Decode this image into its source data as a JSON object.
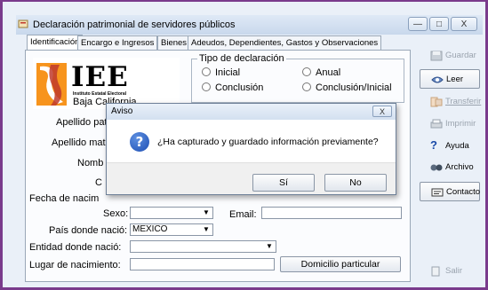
{
  "window": {
    "title": "Declaración patrimonial de servidores públicos",
    "minimize": "—",
    "maximize": "□",
    "close": "X"
  },
  "tabs": [
    {
      "label": "Identificación"
    },
    {
      "label": "Encargo e Ingresos"
    },
    {
      "label": "Bienes"
    },
    {
      "label": "Adeudos, Dependientes, Gastos y Observaciones"
    }
  ],
  "logo": {
    "text": "IEE",
    "subtext": "Instituto Estatal Electoral",
    "region": "Baja California"
  },
  "tipo_declaracion": {
    "legend": "Tipo de declaración",
    "options": [
      {
        "label": "Inicial"
      },
      {
        "label": "Anual"
      },
      {
        "label": "Conclusión"
      },
      {
        "label": "Conclusión/Inicial"
      }
    ]
  },
  "form": {
    "apellido_paterno_label": "Apellido pat",
    "apellido_materno_label": "Apellido mate",
    "nombre_label": "Nomb",
    "curp_label": "C",
    "fecha_label": "Fecha de nacim",
    "sexo_label": "Sexo:",
    "sexo_value": "",
    "email_label": "Email:",
    "pais_label": "País donde nació:",
    "pais_value": "MEXICO",
    "entidad_label": "Entidad donde nació:",
    "lugar_label": "Lugar de nacimiento:",
    "domicilio_button": "Domicilio particular"
  },
  "sidebar": {
    "guardar": "Guardar",
    "leer": "Leer",
    "transferir": "Transferir",
    "imprimir": "Imprimir",
    "ayuda": "Ayuda",
    "archivo": "Archivo",
    "contacto": "Contacto",
    "salir": "Salir"
  },
  "dialog": {
    "title": "Aviso",
    "close": "X",
    "message": "¿Ha capturado y guardado información previamente?",
    "yes": "Sí",
    "no": "No"
  }
}
